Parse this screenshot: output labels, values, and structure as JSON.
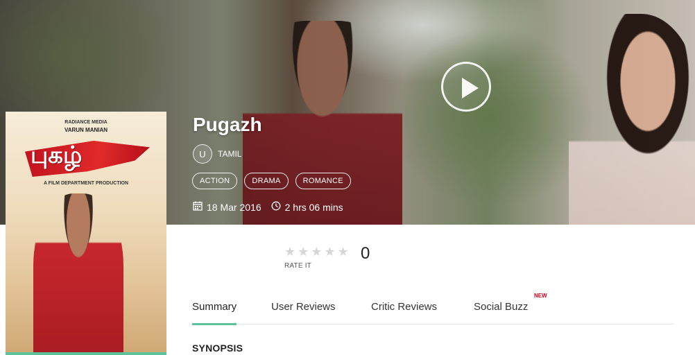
{
  "movie": {
    "title": "Pugazh",
    "certificate": "U",
    "language": "TAMIL",
    "genres": [
      "ACTION",
      "DRAMA",
      "ROMANCE"
    ],
    "release_date": "18 Mar 2016",
    "duration": "2 hrs 06 mins"
  },
  "poster": {
    "studio": "RADIANCE MEDIA",
    "producer": "VARUN MANIAN",
    "title": "புகழ்",
    "credit": "A FILM DEPARTMENT PRODUCTION"
  },
  "rating": {
    "stars_total": 5,
    "stars_filled": 0,
    "count": "0",
    "label": "RATE IT"
  },
  "tabs": [
    {
      "label": "Summary",
      "active": true
    },
    {
      "label": "User Reviews",
      "active": false
    },
    {
      "label": "Critic Reviews",
      "active": false
    },
    {
      "label": "Social Buzz",
      "active": false,
      "badge": "NEW"
    }
  ],
  "section": {
    "synopsis_heading": "SYNOPSIS"
  },
  "icons": {
    "play": "play-icon",
    "calendar": "calendar-icon",
    "clock": "clock-icon",
    "star": "star-icon"
  },
  "colors": {
    "accent": "#5cc29a",
    "new_badge": "#d0021b",
    "star_empty": "#d6d6d6"
  }
}
